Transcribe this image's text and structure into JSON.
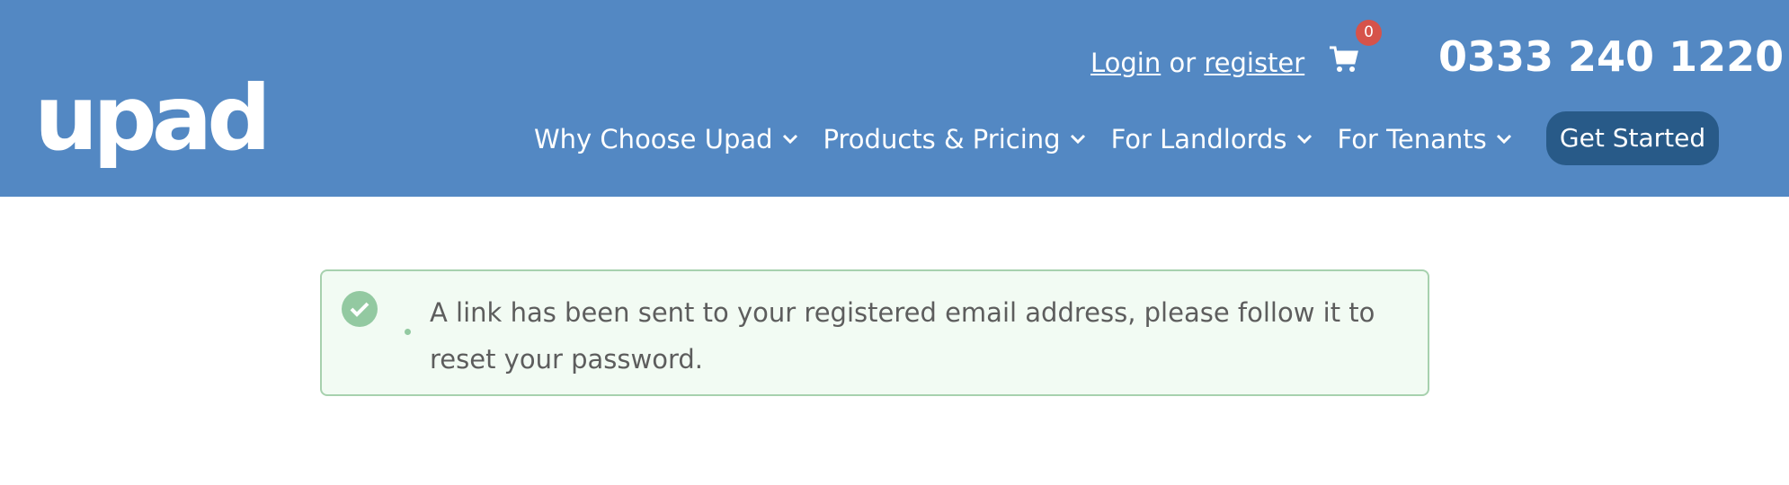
{
  "header": {
    "logo_text": "upad",
    "login_label": "Login",
    "or_text": "or",
    "register_label": "register",
    "cart_count": "0",
    "phone": "0333 240 1220",
    "nav": [
      {
        "label": "Why Choose Upad"
      },
      {
        "label": "Products & Pricing"
      },
      {
        "label": "For Landlords"
      },
      {
        "label": "For Tenants"
      }
    ],
    "cta_label": "Get Started"
  },
  "alert": {
    "message": "A link has been sent to your registered email address, please follow it to reset your password."
  },
  "colors": {
    "header_bg": "#5388c3",
    "cta_bg": "#285a88",
    "badge_bg": "#d6534a",
    "alert_bg": "#f2fbf3",
    "alert_border": "#a7d1ae",
    "success_icon": "#93c9a1"
  },
  "icons": {
    "cart": "cart-icon",
    "chevron": "chevron-down-icon",
    "success": "check-circle-icon"
  }
}
